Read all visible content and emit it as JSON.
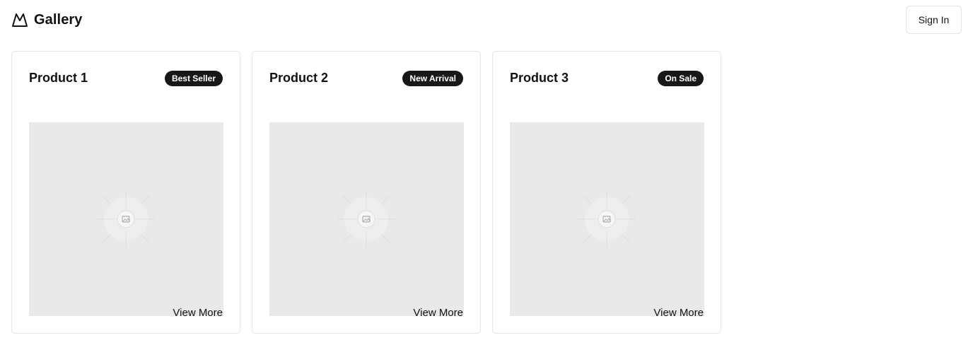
{
  "header": {
    "brand": {
      "icon": "mountain-logo-icon",
      "title": "Gallery"
    },
    "sign_in_label": "Sign In"
  },
  "products": [
    {
      "title": "Product 1",
      "badge": "Best Seller",
      "image_icon": "image-placeholder-icon",
      "link_label": "View More"
    },
    {
      "title": "Product 2",
      "badge": "New Arrival",
      "image_icon": "image-placeholder-icon",
      "link_label": "View More"
    },
    {
      "title": "Product 3",
      "badge": "On Sale",
      "image_icon": "image-placeholder-icon",
      "link_label": "View More"
    }
  ],
  "colors": {
    "badge_background": "#18181b",
    "badge_text": "#ffffff",
    "image_placeholder": "#e9e9e9",
    "card_border": "#e6e6e6"
  }
}
